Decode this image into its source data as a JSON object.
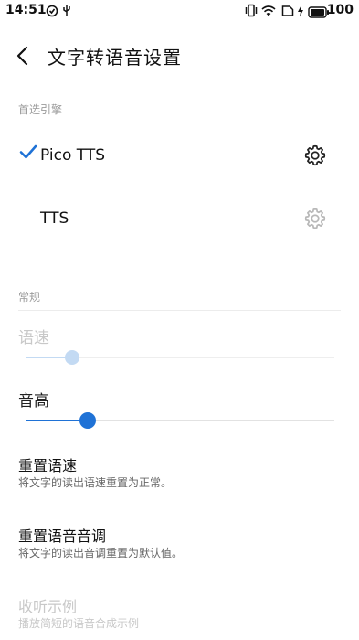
{
  "status_bar": {
    "time": "14:51",
    "battery": "100",
    "icons": [
      "sync-icon",
      "usb-icon",
      "vibrate-icon",
      "wifi-icon",
      "no-sim-icon",
      "charging-icon",
      "battery-icon"
    ]
  },
  "header": {
    "title": "文字转语音设置",
    "back_icon": "back-arrow-icon"
  },
  "sections": {
    "preferred_engine": {
      "header": "首选引擎",
      "engines": [
        {
          "label": "Pico TTS",
          "selected": true,
          "settings_enabled": true
        },
        {
          "label": "TTS",
          "selected": false,
          "settings_enabled": false
        }
      ]
    },
    "general": {
      "header": "常规",
      "speech_rate": {
        "label": "语速",
        "enabled": false,
        "value_fraction": 0.15
      },
      "pitch": {
        "label": "音高",
        "enabled": true,
        "value_fraction": 0.2
      },
      "reset_speed": {
        "title": "重置语速",
        "subtitle": "将文字的读出语速重置为正常。"
      },
      "reset_pitch": {
        "title": "重置语音音调",
        "subtitle": "将文字的读出音调重置为默认值。"
      },
      "listen_example": {
        "title": "收听示例",
        "subtitle": "播放简短的语音合成示例",
        "enabled": false
      }
    }
  },
  "colors": {
    "accent": "#1f72d6",
    "accent_disabled": "#c3daf3",
    "disabled_text": "#c8c8c8"
  }
}
